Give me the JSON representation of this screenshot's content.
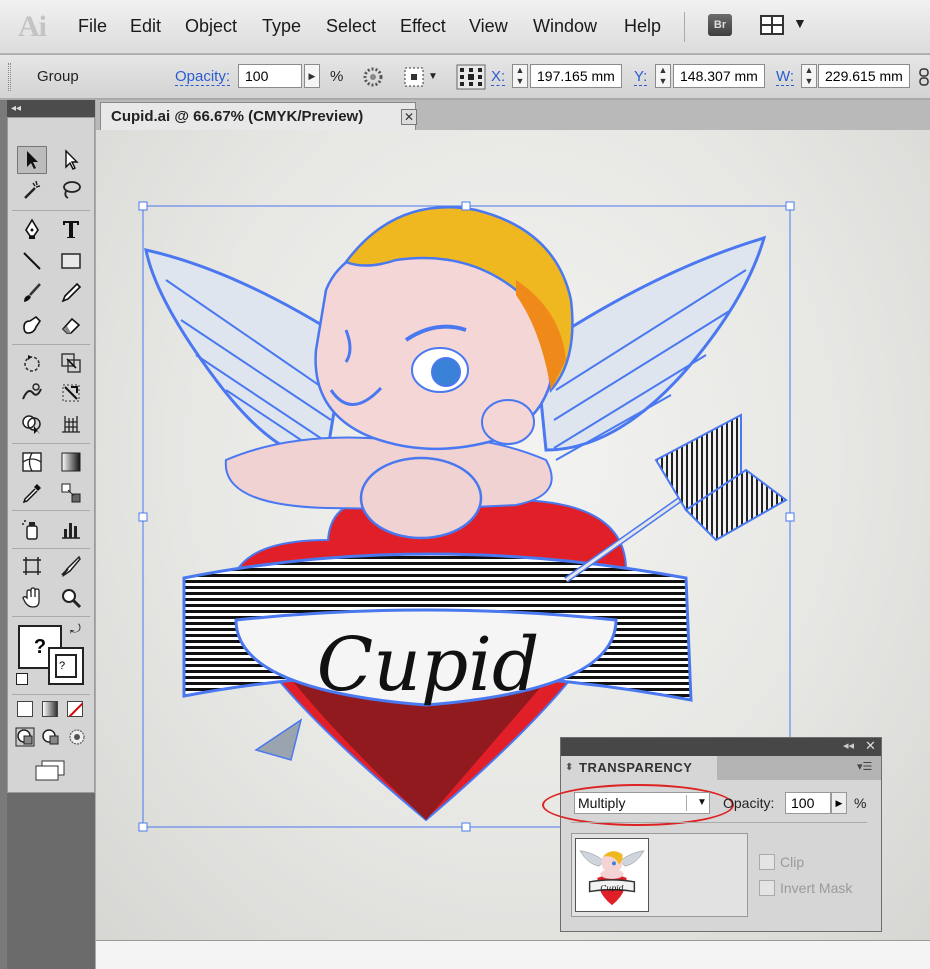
{
  "app": {
    "logo": "Ai",
    "menu": [
      "File",
      "Edit",
      "Object",
      "Type",
      "Select",
      "Effect",
      "View",
      "Window",
      "Help"
    ],
    "bridge_label": "Br"
  },
  "control_bar": {
    "selection_type": "Group",
    "opacity_label": "Opacity:",
    "opacity_value": "100",
    "opacity_unit": "%",
    "x_label": "X:",
    "x_value": "197.165 mm",
    "y_label": "Y:",
    "y_value": "148.307 mm",
    "w_label": "W:",
    "w_value": "229.615 mm"
  },
  "document": {
    "tab_title": "Cupid.ai @ 66.67% (CMYK/Preview)",
    "artwork_text": "Cupid"
  },
  "tools_panel": {
    "fill_stroke_label": "?",
    "small_label": "?"
  },
  "transparency_panel": {
    "title": "TRANSPARENCY",
    "blend_mode": "Multiply",
    "opacity_label": "Opacity:",
    "opacity_value": "100",
    "opacity_unit": "%",
    "clip_label": "Clip",
    "invert_mask_label": "Invert Mask",
    "clip_checked": false,
    "invert_mask_checked": false,
    "thumbnail_text": "Cupid"
  },
  "colors": {
    "selection": "#4a78f0",
    "highlight_circle": "#d22222",
    "heart_red": "#e11f28",
    "heart_dark": "#8b1a1e",
    "hair": "#f0b820"
  }
}
